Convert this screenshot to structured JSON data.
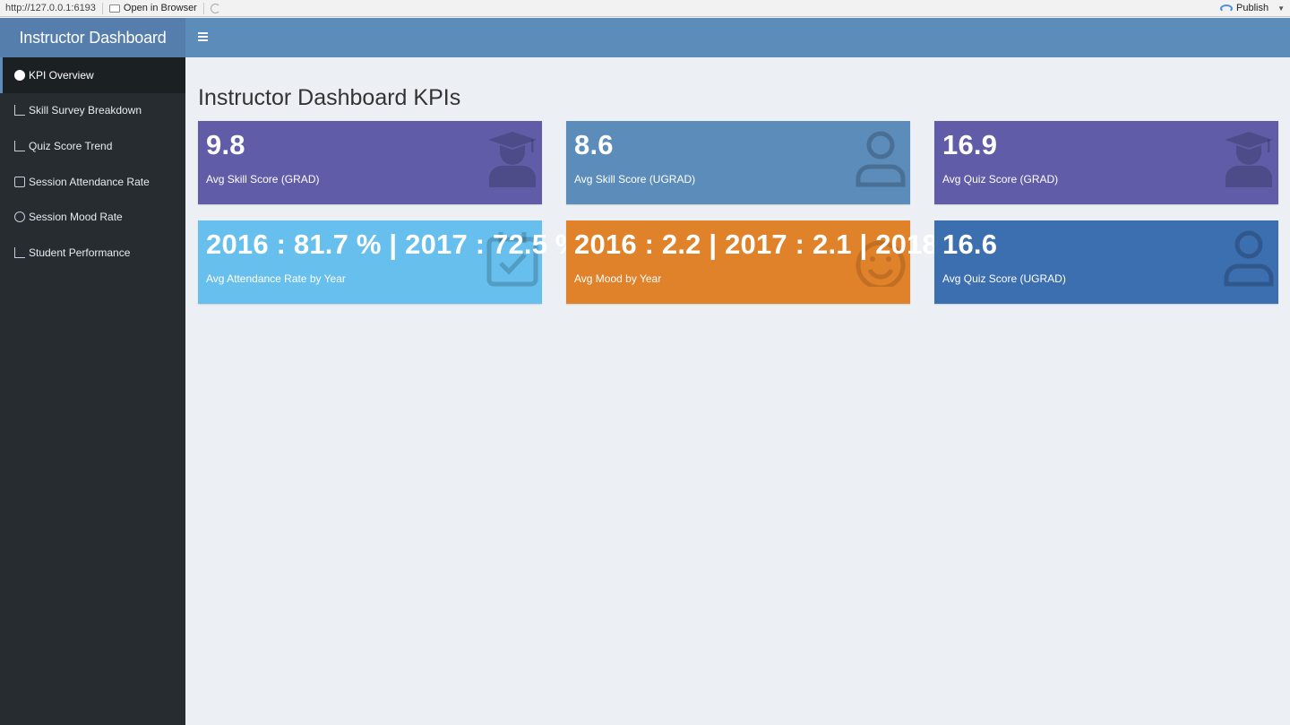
{
  "browser": {
    "url": "http://127.0.0.1:6193",
    "open_in_browser": "Open in Browser",
    "publish": "Publish"
  },
  "header": {
    "logo": "Instructor Dashboard"
  },
  "sidebar": {
    "items": [
      {
        "label": "KPI Overview",
        "icon": "dashboard-icon",
        "active": true
      },
      {
        "label": "Skill Survey Breakdown",
        "icon": "bar-chart-icon"
      },
      {
        "label": "Quiz Score Trend",
        "icon": "line-chart-icon"
      },
      {
        "label": "Session Attendance Rate",
        "icon": "calendar-check-icon"
      },
      {
        "label": "Session Mood Rate",
        "icon": "smile-icon"
      },
      {
        "label": "Student Performance",
        "icon": "line-chart-icon"
      }
    ]
  },
  "main": {
    "title": "Instructor Dashboard KPIs",
    "boxes": [
      {
        "value": "9.8",
        "label": "Avg Skill Score (GRAD)",
        "color": "#605ca8",
        "icon": "graduation-cap-icon"
      },
      {
        "value": "8.6",
        "label": "Avg Skill Score (UGRAD)",
        "color": "#5c8cba",
        "icon": "user-icon"
      },
      {
        "value": "16.9",
        "label": "Avg Quiz Score (GRAD)",
        "color": "#605ca8",
        "icon": "graduation-cap-icon"
      },
      {
        "value": "2016 : 81.7 % | 2017 : 72.5 %",
        "label": "Avg Attendance Rate by Year",
        "color": "#66bfed",
        "icon": "calendar-check-icon"
      },
      {
        "value": "2016 : 2.2 | 2017 : 2.1 | 2018",
        "label": "Avg Mood by Year",
        "color": "#e0822a",
        "icon": "smile-icon"
      },
      {
        "value": "16.6",
        "label": "Avg Quiz Score (UGRAD)",
        "color": "#3c6fb0",
        "icon": "user-icon"
      }
    ]
  }
}
